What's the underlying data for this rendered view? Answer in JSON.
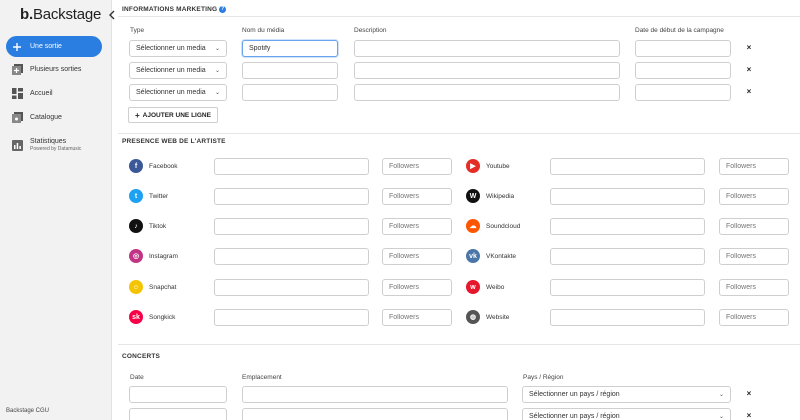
{
  "sidebar": {
    "logo_mark": "b.",
    "logo_text": "Backstage",
    "collapse_icon": "chevron-left-icon",
    "items": [
      {
        "label": "Une sortie",
        "icon": "plus-icon"
      },
      {
        "label": "Plusieurs sorties",
        "icon": "add-multiple-icon"
      },
      {
        "label": "Accueil",
        "icon": "dashboard-icon"
      },
      {
        "label": "Catalogue",
        "icon": "catalogue-icon"
      },
      {
        "label": "Statistiques",
        "sub": "Powered by Datamusic",
        "icon": "chart-icon"
      }
    ],
    "footer": "Backstage CGU"
  },
  "marketing": {
    "title": "INFORMATIONS MARKETING",
    "help": "?",
    "col_type": "Type",
    "col_media": "Nom du média",
    "col_desc": "Description",
    "col_date": "Date de début de la campagne",
    "rows": [
      {
        "type": "Sélectionner un media",
        "media": "Spotify",
        "desc": "",
        "date": ""
      },
      {
        "type": "Sélectionner un media",
        "media": "",
        "desc": "",
        "date": ""
      },
      {
        "type": "Sélectionner un media",
        "media": "",
        "desc": "",
        "date": ""
      }
    ],
    "remove": "×",
    "add_label": "AJOUTER UNE LIGNE",
    "add_plus": "+"
  },
  "presence": {
    "title": "PRESENCE WEB DE L'ARTISTE",
    "followers_placeholder": "Followers",
    "left": [
      {
        "name": "Facebook",
        "glyph": "f",
        "color": "#3b5998"
      },
      {
        "name": "Twitter",
        "glyph": "t",
        "color": "#1da1f2"
      },
      {
        "name": "Tiktok",
        "glyph": "♪",
        "color": "#111111"
      },
      {
        "name": "Instagram",
        "glyph": "◎",
        "color": "#c13584"
      },
      {
        "name": "Snapchat",
        "glyph": "☺",
        "color": "#f5c400"
      },
      {
        "name": "Songkick",
        "glyph": "sk",
        "color": "#f80046"
      }
    ],
    "right": [
      {
        "name": "Youtube",
        "glyph": "▶",
        "color": "#e52d27"
      },
      {
        "name": "Wikipedia",
        "glyph": "W",
        "color": "#111111"
      },
      {
        "name": "Soundcloud",
        "glyph": "☁",
        "color": "#ff5500"
      },
      {
        "name": "VKontakte",
        "glyph": "vk",
        "color": "#4a76a8"
      },
      {
        "name": "Weibo",
        "glyph": "w",
        "color": "#e6162d"
      },
      {
        "name": "Website",
        "glyph": "◍",
        "color": "#555555"
      }
    ]
  },
  "concerts": {
    "title": "CONCERTS",
    "col_date": "Date",
    "col_place": "Emplacement",
    "col_country": "Pays / Région",
    "rows": [
      {
        "country": "Sélectionner un pays / région"
      },
      {
        "country": "Sélectionner un pays / région"
      }
    ],
    "remove": "×"
  },
  "colors": {
    "accent": "#2a7de1"
  }
}
